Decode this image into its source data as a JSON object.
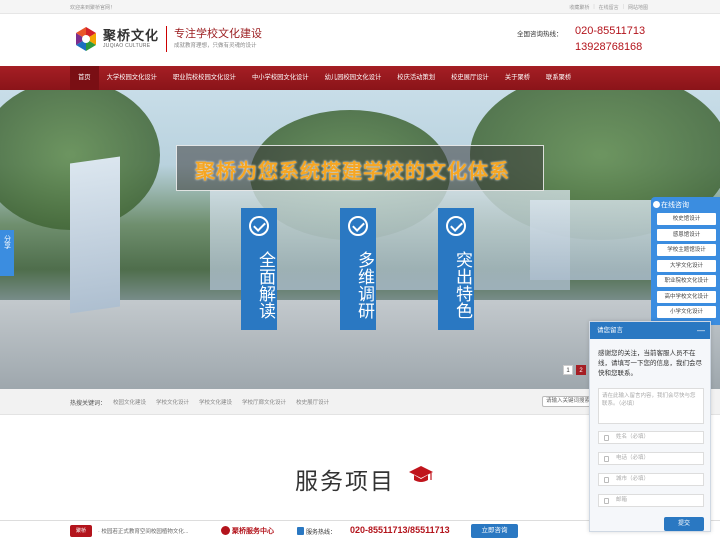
{
  "topbar": {
    "welcome": "欢迎来到聚桥官网！",
    "links": [
      "收藏聚桥",
      "在线留言",
      "网站地图"
    ]
  },
  "header": {
    "logo_cn": "聚桥文化",
    "logo_en": "JUQIAO CULTURE",
    "slogan_main": "专注学校文化建设",
    "slogan_sub": "成就教育理想，只做有灵魂的设计",
    "hotline_label": "全国咨询热线：",
    "hotline_1": "020-85511713",
    "hotline_2": "13928768168"
  },
  "nav": {
    "items": [
      "首页",
      "大学校园文化设计",
      "职业院校校园文化设计",
      "中小学校园文化设计",
      "幼儿园校园文化设计",
      "校庆活动策划",
      "校史展厅设计",
      "关于聚桥",
      "联系聚桥"
    ]
  },
  "banner": {
    "headline": "聚桥为您系统搭建学校的文化体系",
    "pillars": [
      "全面解读",
      "多维调研",
      "突出特色"
    ],
    "slide_dots": [
      "1",
      "2"
    ],
    "share_label": "分享"
  },
  "keywords": {
    "label": "热搜关键词：",
    "items": [
      "校园文化建设",
      "学校文化设计",
      "学校文化建设",
      "学校厅廊文化设计",
      "校史展厅设计"
    ],
    "search_placeholder": "请输入关键词搜索"
  },
  "services": {
    "title": "服务项目"
  },
  "sidebar_menu": {
    "title": "在线咨询",
    "items": [
      "校史馆设计",
      "感恩馆设计",
      "学校主题馆设计",
      "大学文化设计",
      "职业院校文化设计",
      "高中学校文化设计",
      "小学文化设计"
    ]
  },
  "chat": {
    "header": "请您留言",
    "message": "感谢您的关注，当前客服人员不在线，请填写一下您的信息，我们会尽快和您联系。",
    "textarea_placeholder": "请在此输入留言内容，我们会尽快与您联系。（必填）",
    "field_name": "姓名（必填）",
    "field_phone": "电话（必填）",
    "field_city": "城市（必填）",
    "field_email": "邮箱",
    "submit": "提交"
  },
  "footer": {
    "logo_text": "聚桥",
    "news": "· 校园若正式教育空间校园植物文化...",
    "service_center": "聚桥服务中心",
    "phone_label": "服务热线：",
    "phone": "020-85511713/85511713",
    "consult_button": "立即咨询"
  },
  "colors": {
    "brand_red": "#a51e24",
    "accent_blue": "#2a78c2",
    "headline_orange": "#f6a623"
  }
}
